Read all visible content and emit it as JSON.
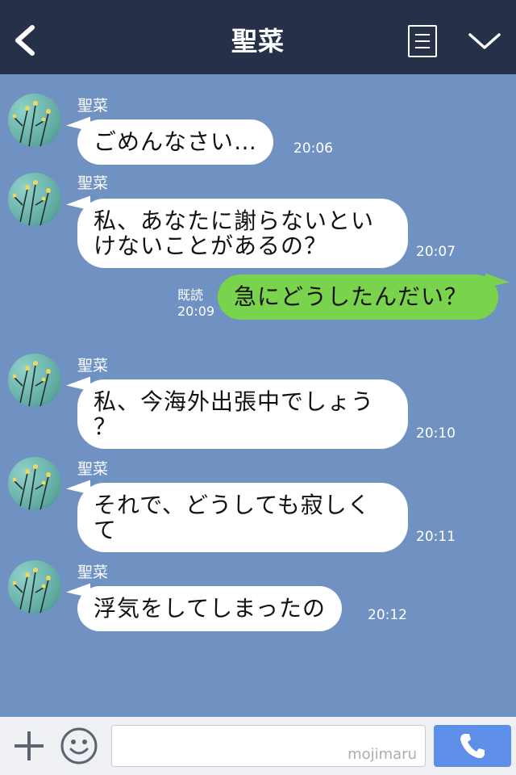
{
  "header": {
    "title": "聖菜",
    "icons": {
      "back": "back-icon",
      "menu": "menu-icon",
      "collapse": "chevron-down-icon"
    }
  },
  "messages": [
    {
      "type": "incoming",
      "sender": "聖菜",
      "text": "ごめんなさい…",
      "time": "20:06"
    },
    {
      "type": "incoming",
      "sender": "聖菜",
      "text": "私、あなたに謝らないとい\nけないことがあるの？",
      "time": "20:07"
    },
    {
      "type": "outgoing",
      "read": "既読",
      "text": "急にどうしたんだい？",
      "time": "20:09"
    },
    {
      "type": "incoming",
      "sender": "聖菜",
      "text": "私、今海外出張中でしょう\n？",
      "time": "20:10"
    },
    {
      "type": "incoming",
      "sender": "聖菜",
      "text": "それで、どうしても寂しく\nて",
      "time": "20:11"
    },
    {
      "type": "incoming",
      "sender": "聖菜",
      "text": "浮気をしてしまったの",
      "time": "20:12"
    }
  ],
  "footer": {
    "input_value": "",
    "watermark": "mojimaru",
    "icons": {
      "add": "plus-icon",
      "sticker": "smile-icon",
      "call": "phone-icon"
    }
  },
  "colors": {
    "header_bg": "#263149",
    "chat_bg": "#7092c2",
    "outgoing_bubble": "#7ad34c",
    "incoming_bubble": "#ffffff",
    "call_button": "#5d8fe8"
  }
}
